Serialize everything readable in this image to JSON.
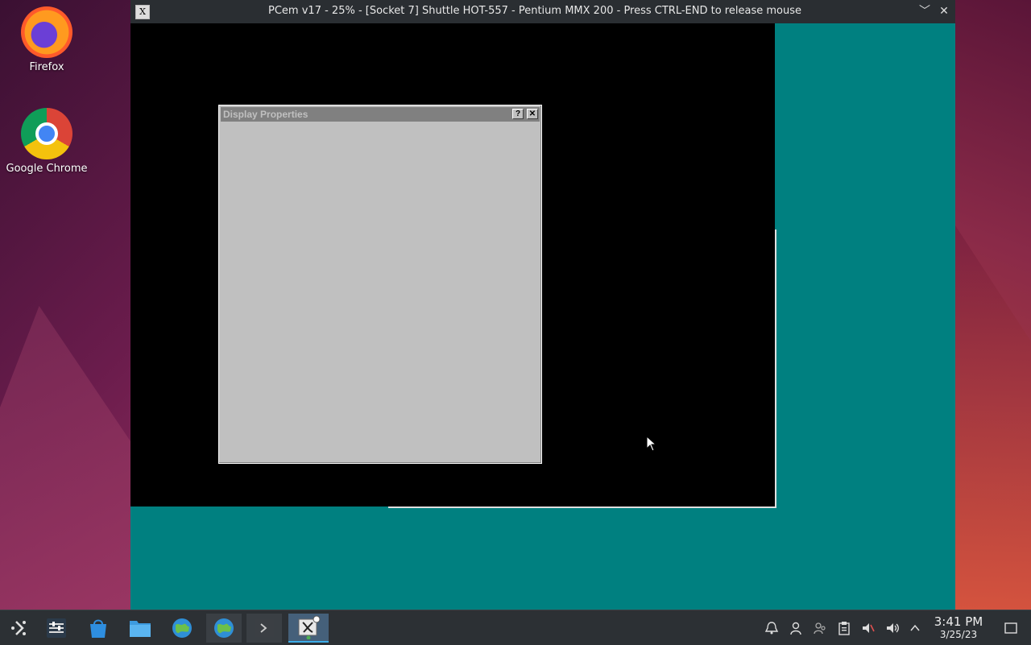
{
  "desktop": {
    "icons": [
      {
        "label": "Firefox"
      },
      {
        "label": "Google Chrome"
      }
    ]
  },
  "window": {
    "title": "PCem v17 - 25% - [Socket 7] Shuttle HOT-557 - Pentium MMX 200 - Press CTRL-END to release mouse",
    "app_icon_glyph": "X",
    "minimize_glyph": "﹀",
    "close_glyph": "✕"
  },
  "guest": {
    "dialog": {
      "title": "Display Properties",
      "help_glyph": "?",
      "close_glyph": "✕"
    },
    "desktop_color": "#008080"
  },
  "taskbar": {
    "items": [
      {
        "name": "application-launcher",
        "icon": "launcher-icon"
      },
      {
        "name": "system-settings",
        "icon": "sliders-icon"
      },
      {
        "name": "discover",
        "icon": "store-icon"
      },
      {
        "name": "dolphin",
        "icon": "folder-icon"
      },
      {
        "name": "browser-1",
        "icon": "globe-icon"
      },
      {
        "name": "browser-2",
        "icon": "globe-icon"
      },
      {
        "name": "konsole",
        "icon": "terminal-icon"
      },
      {
        "name": "pcem",
        "icon": "pcem-icon"
      }
    ],
    "clock": {
      "time": "3:41 PM",
      "date": "3/25/23"
    }
  }
}
